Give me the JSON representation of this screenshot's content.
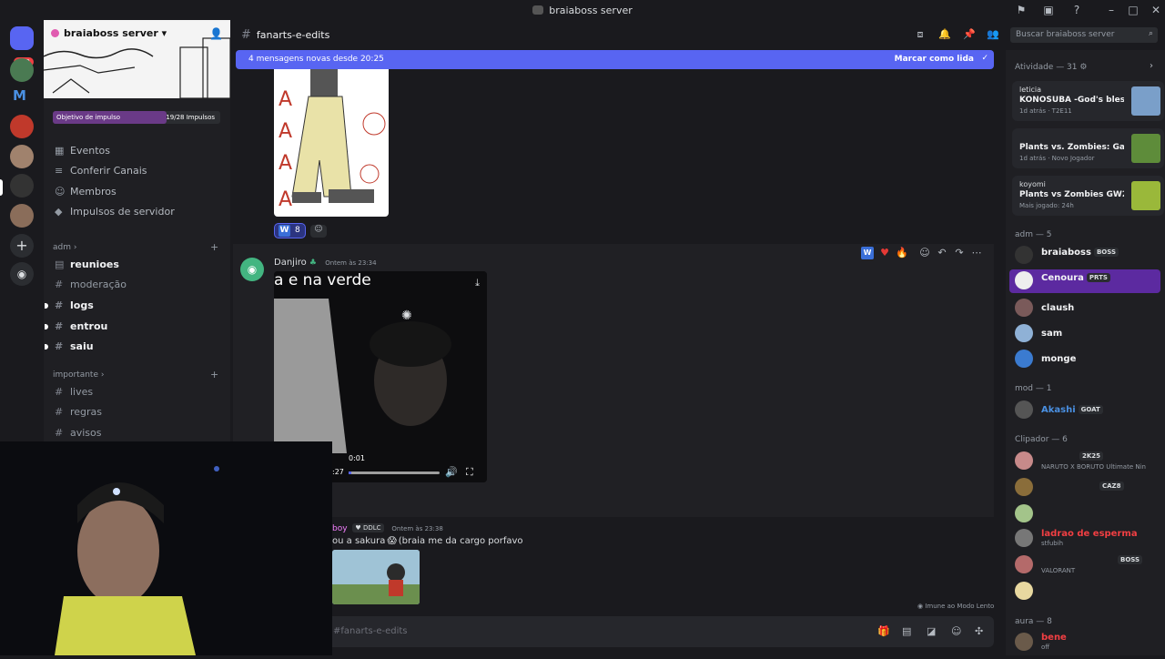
{
  "window": {
    "title": "braiaboss server"
  },
  "servers": {
    "mentions_badge": "309",
    "m_label": "M"
  },
  "server_header": {
    "name": "braiaboss server"
  },
  "boost": {
    "label": "Objetivo de impulso",
    "count": "19/28 Impulsos",
    "progress": 0.68
  },
  "nav": {
    "items": [
      {
        "label": "Eventos"
      },
      {
        "label": "Conferir Canais"
      },
      {
        "label": "Membros"
      },
      {
        "label": "Impulsos de servidor"
      }
    ]
  },
  "categories": {
    "adm": {
      "label": "adm",
      "channels": [
        "reunioes",
        "moderação",
        "logs",
        "entrou",
        "saiu"
      ]
    },
    "importante": {
      "label": "importante",
      "channels": [
        "lives",
        "regras",
        "avisos"
      ]
    }
  },
  "channel": {
    "name": "fanarts-e-edits",
    "search_placeholder": "Buscar braiaboss server"
  },
  "new_messages": {
    "text": "4 mensagens novas desde 20:25",
    "action": "Marcar como lida"
  },
  "reactions": {
    "count": "8"
  },
  "messages": {
    "m1": {
      "author": "Danjiro",
      "time": "Ontem às 23:34"
    },
    "video": {
      "caption": "a e na verde",
      "current": "0:01",
      "remaining": ":27",
      "progress": 0.03
    },
    "m2": {
      "author": "boy",
      "badge": "DDLC",
      "time": "Ontem às 23:38",
      "text": "ou a sakura",
      "text2": "(braia me da cargo porfavo"
    }
  },
  "slow_mode": "Imune ao Modo Lento",
  "composer": {
    "placeholder": "#fanarts-e-edits"
  },
  "members": {
    "activity": {
      "label": "Atividade — 31"
    },
    "activities": [
      {
        "user": "leticia",
        "game": "KONOSUBA -God's blessin...",
        "meta": "1d atrás",
        "extra": "T2E11"
      },
      {
        "user": "",
        "game": "Plants vs. Zombies: Game ...",
        "meta": "1d atrás",
        "extra": "Novo Jogador"
      },
      {
        "user": "koyomi",
        "game": "Plants vs Zombies GW2",
        "meta": "Mais jogado: 24h",
        "extra": ""
      }
    ],
    "groups": [
      {
        "label": "adm — 5"
      },
      {
        "label": "mod — 1"
      },
      {
        "label": "Clipador — 6"
      },
      {
        "label": "aura — 8"
      }
    ],
    "adm": [
      {
        "name": "braiaboss",
        "tag": "BOSS"
      },
      {
        "name": "Cenoura",
        "tag": "PRTS"
      },
      {
        "name": "claush",
        "tag": ""
      },
      {
        "name": "sam",
        "tag": ""
      },
      {
        "name": "monge",
        "tag": ""
      }
    ],
    "mod": [
      {
        "name": "Akashi",
        "tag": "GOAT"
      }
    ],
    "clipador": [
      {
        "name": "",
        "tag": "2K25",
        "sub": "NARUTO X BORUTO Ultimate Nin"
      },
      {
        "name": "",
        "tag": "CAZ8",
        "sub": ""
      },
      {
        "name": "",
        "tag": "",
        "sub": ""
      },
      {
        "name": "ladrao de esperma",
        "tag": "",
        "sub": "stfubih"
      },
      {
        "name": "",
        "tag": "BOSS",
        "sub": "VALORANT"
      },
      {
        "name": "",
        "tag": "",
        "sub": ""
      }
    ],
    "aura": [
      {
        "name": "bene",
        "sub": "off"
      }
    ]
  },
  "colors": {
    "accent": "#5865f2",
    "boost": "#6a3a87",
    "red_name": "#f23f43",
    "akashi": "#4a90e2"
  }
}
